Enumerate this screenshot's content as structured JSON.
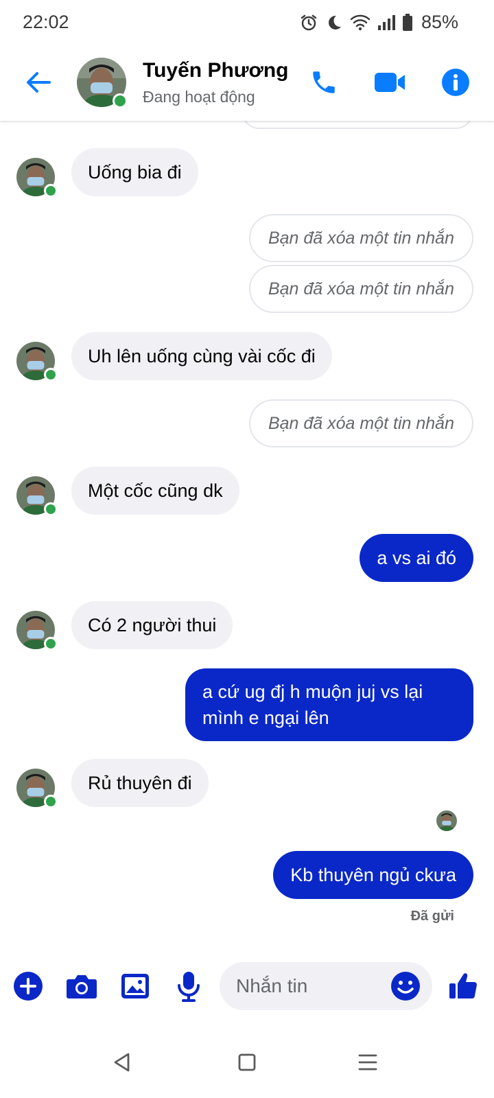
{
  "status_bar": {
    "time": "22:02",
    "battery": "85%",
    "icons": [
      "alarm-icon",
      "moon-icon",
      "wifi-icon",
      "signal-icon",
      "battery-icon"
    ]
  },
  "header": {
    "contact_name": "Tuyến Phương",
    "contact_status": "Đang hoạt động",
    "icons": [
      "back-arrow-icon",
      "phone-icon",
      "video-camera-icon",
      "info-icon"
    ]
  },
  "messages": [
    {
      "direction": "in",
      "text": "Uống bia đi"
    },
    {
      "direction": "out",
      "deleted": true,
      "text": "Bạn đã xóa một tin nhắn"
    },
    {
      "direction": "out",
      "deleted": true,
      "text": "Bạn đã xóa một tin nhắn"
    },
    {
      "direction": "in",
      "text": "Uh lên uống cùng vài cốc đi"
    },
    {
      "direction": "out",
      "deleted": true,
      "text": "Bạn đã xóa một tin nhắn"
    },
    {
      "direction": "in",
      "text": "Một cốc cũng dk"
    },
    {
      "direction": "out",
      "text": "a vs ai đó"
    },
    {
      "direction": "in",
      "text": "Có 2 người thui"
    },
    {
      "direction": "out",
      "text": "a cứ ug đj h muộn juj vs lại mình e ngại lên"
    },
    {
      "direction": "in",
      "text": "Rủ thuyên đi"
    },
    {
      "direction": "out",
      "text": "Kb thuyên ngủ ckưa"
    }
  ],
  "sent_status": "Đã gửi",
  "composer": {
    "placeholder": "Nhắn tin",
    "icons": [
      "plus-icon",
      "camera-icon",
      "image-icon",
      "microphone-icon",
      "emoji-icon",
      "thumbs-up-icon"
    ]
  },
  "nav_bar": {
    "icons": [
      "back-triangle-icon",
      "home-square-icon",
      "menu-lines-icon"
    ]
  },
  "colors": {
    "accent": "#0a7cff",
    "outgoing_bubble": "#0a28c8",
    "incoming_bubble": "#f0f0f5",
    "online": "#31a24c"
  }
}
